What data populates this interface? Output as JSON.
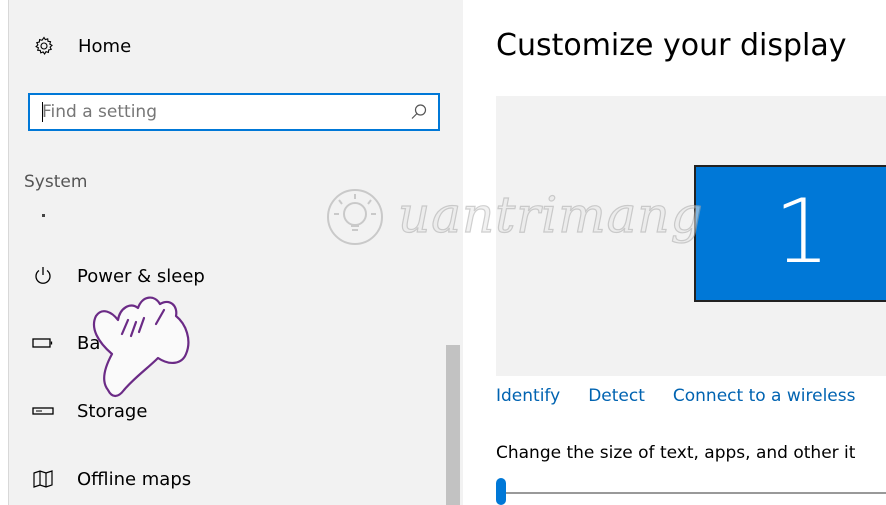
{
  "sidebar": {
    "home_label": "Home",
    "search": {
      "placeholder": "Find a setting",
      "value": ""
    },
    "section_title": "System",
    "items": [
      {
        "label": "Power & sleep",
        "icon": "power-icon"
      },
      {
        "label": "Ba",
        "icon": "battery-icon"
      },
      {
        "label": "Storage",
        "icon": "storage-icon"
      },
      {
        "label": "Offline maps",
        "icon": "map-icon"
      }
    ]
  },
  "main": {
    "title": "Customize your display",
    "monitor_number": "1",
    "links": [
      "Identify",
      "Detect",
      "Connect to a wireless"
    ],
    "scale_label": "Change the size of text, apps, and other it",
    "scale_slider": {
      "value": 0
    }
  },
  "watermark": {
    "text": "uantrimang"
  },
  "colors": {
    "accent": "#0078d7",
    "link": "#0063b1",
    "sidebar_bg": "#f2f2f2",
    "preview_bg": "#f2f2f2",
    "cursor_stroke": "#6b2b86"
  }
}
